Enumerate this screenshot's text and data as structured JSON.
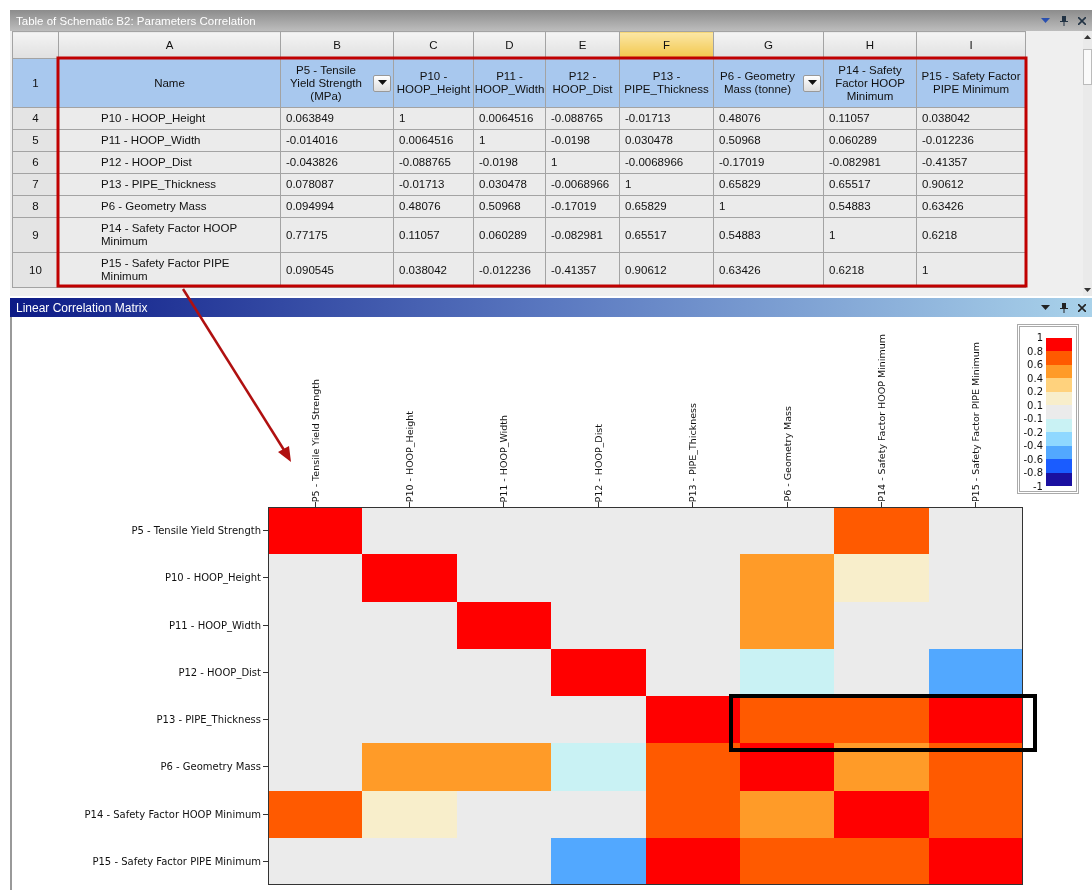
{
  "table_panel": {
    "title": "Table of Schematic B2: Parameters Correlation",
    "columns": [
      {
        "letter": "A",
        "selected": false
      },
      {
        "letter": "B",
        "selected": false
      },
      {
        "letter": "C",
        "selected": false
      },
      {
        "letter": "D",
        "selected": false
      },
      {
        "letter": "E",
        "selected": false
      },
      {
        "letter": "F",
        "selected": true
      },
      {
        "letter": "G",
        "selected": false
      },
      {
        "letter": "H",
        "selected": false
      },
      {
        "letter": "I",
        "selected": false
      }
    ],
    "header_row": {
      "number": "1",
      "cells": [
        {
          "text": "Name",
          "filter": false
        },
        {
          "text": "P5 - Tensile Yield Strength (MPa)",
          "filter": true
        },
        {
          "text": "P10 - HOOP_Height",
          "filter": false
        },
        {
          "text": "P11 - HOOP_Width",
          "filter": false
        },
        {
          "text": "P12 - HOOP_Dist",
          "filter": false
        },
        {
          "text": "P13 - PIPE_Thickness",
          "filter": false
        },
        {
          "text": "P6 - Geometry Mass (tonne)",
          "filter": true
        },
        {
          "text": "P14 - Safety Factor HOOP Minimum",
          "filter": false
        },
        {
          "text": "P15 - Safety Factor PIPE Minimum",
          "filter": false
        }
      ]
    },
    "rows": [
      {
        "number": "4",
        "cells": [
          "P10 - HOOP_Height",
          "0.063849",
          "1",
          "0.0064516",
          "-0.088765",
          "-0.01713",
          "0.48076",
          "0.11057",
          "0.038042"
        ]
      },
      {
        "number": "5",
        "cells": [
          "P11 - HOOP_Width",
          "-0.014016",
          "0.0064516",
          "1",
          "-0.0198",
          "0.030478",
          "0.50968",
          "0.060289",
          "-0.012236"
        ]
      },
      {
        "number": "6",
        "cells": [
          "P12 - HOOP_Dist",
          "-0.043826",
          "-0.088765",
          "-0.0198",
          "1",
          "-0.0068966",
          "-0.17019",
          "-0.082981",
          "-0.41357"
        ]
      },
      {
        "number": "7",
        "cells": [
          "P13 - PIPE_Thickness",
          "0.078087",
          "-0.01713",
          "0.030478",
          "-0.0068966",
          "1",
          "0.65829",
          "0.65517",
          "0.90612"
        ]
      },
      {
        "number": "8",
        "cells": [
          "P6 - Geometry Mass",
          "0.094994",
          "0.48076",
          "0.50968",
          "-0.17019",
          "0.65829",
          "1",
          "0.54883",
          "0.63426"
        ]
      },
      {
        "number": "9",
        "cells": [
          "P14 - Safety Factor HOOP Minimum",
          "0.77175",
          "0.11057",
          "0.060289",
          "-0.082981",
          "0.65517",
          "0.54883",
          "1",
          "0.6218"
        ]
      },
      {
        "number": "10",
        "cells": [
          "P15 - Safety Factor PIPE Minimum",
          "0.090545",
          "0.038042",
          "-0.012236",
          "-0.41357",
          "0.90612",
          "0.63426",
          "0.6218",
          "1"
        ]
      }
    ]
  },
  "matrix_panel": {
    "title": "Linear Correlation Matrix",
    "column_labels": [
      "P5 - Tensile Yield Strength",
      "P10 - HOOP_Height",
      "P11 - HOOP_Width",
      "P12 - HOOP_Dist",
      "P13 - PIPE_Thickness",
      "P6 - Geometry Mass",
      "P14 - Safety Factor HOOP Minimum",
      "P15 - Safety Factor PIPE Minimum"
    ],
    "rows": [
      {
        "label": "P5 - Tensile Yield Strength",
        "cells": [
          {
            "color": "#ff0000"
          },
          {
            "color": "#ebebeb"
          },
          {
            "color": "#ebebeb"
          },
          {
            "color": "#ebebeb"
          },
          {
            "color": "#ebebeb"
          },
          {
            "color": "#ebebeb"
          },
          {
            "color": "#ff5a00"
          },
          {
            "color": "#ebebeb"
          }
        ]
      },
      {
        "label": "P10 - HOOP_Height",
        "cells": [
          {
            "color": "#ebebeb"
          },
          {
            "color": "#ff0000"
          },
          {
            "color": "#ebebeb"
          },
          {
            "color": "#ebebeb"
          },
          {
            "color": "#ebebeb"
          },
          {
            "color": "#ff9b28"
          },
          {
            "color": "#f8eecb"
          },
          {
            "color": "#ebebeb"
          }
        ]
      },
      {
        "label": "P11 - HOOP_Width",
        "cells": [
          {
            "color": "#ebebeb"
          },
          {
            "color": "#ebebeb"
          },
          {
            "color": "#ff0000"
          },
          {
            "color": "#ebebeb"
          },
          {
            "color": "#ebebeb"
          },
          {
            "color": "#ff9b28"
          },
          {
            "color": "#ebebeb"
          },
          {
            "color": "#ebebeb"
          }
        ]
      },
      {
        "label": "P12 - HOOP_Dist",
        "cells": [
          {
            "color": "#ebebeb"
          },
          {
            "color": "#ebebeb"
          },
          {
            "color": "#ebebeb"
          },
          {
            "color": "#ff0000"
          },
          {
            "color": "#ebebeb"
          },
          {
            "color": "#c9f2f4"
          },
          {
            "color": "#ebebeb"
          },
          {
            "color": "#52a8ff"
          }
        ]
      },
      {
        "label": "P13 - PIPE_Thickness",
        "cells": [
          {
            "color": "#ebebeb"
          },
          {
            "color": "#ebebeb"
          },
          {
            "color": "#ebebeb"
          },
          {
            "color": "#ebebeb"
          },
          {
            "color": "#ff0000"
          },
          {
            "color": "#ff5a00"
          },
          {
            "color": "#ff5a00"
          },
          {
            "color": "#ff0000"
          }
        ]
      },
      {
        "label": "P6 - Geometry Mass",
        "cells": [
          {
            "color": "#ebebeb"
          },
          {
            "color": "#ff9b28"
          },
          {
            "color": "#ff9b28"
          },
          {
            "color": "#c9f2f4"
          },
          {
            "color": "#ff5a00"
          },
          {
            "color": "#ff0000"
          },
          {
            "color": "#ff9b28"
          },
          {
            "color": "#ff5a00"
          }
        ]
      },
      {
        "label": "P14 - Safety Factor HOOP Minimum",
        "cells": [
          {
            "color": "#ff5a00"
          },
          {
            "color": "#f8eecb"
          },
          {
            "color": "#ebebeb"
          },
          {
            "color": "#ebebeb"
          },
          {
            "color": "#ff5a00"
          },
          {
            "color": "#ff9b28"
          },
          {
            "color": "#ff0000"
          },
          {
            "color": "#ff5a00"
          }
        ]
      },
      {
        "label": "P15 - Safety Factor PIPE Minimum",
        "cells": [
          {
            "color": "#ebebeb"
          },
          {
            "color": "#ebebeb"
          },
          {
            "color": "#ebebeb"
          },
          {
            "color": "#52a8ff"
          },
          {
            "color": "#ff0000"
          },
          {
            "color": "#ff5a00"
          },
          {
            "color": "#ff5a00"
          },
          {
            "color": "#ff0000"
          }
        ]
      }
    ],
    "legend_labels": [
      "1",
      "0.8",
      "0.6",
      "0.4",
      "0.2",
      "0.1",
      "-0.1",
      "-0.2",
      "-0.4",
      "-0.6",
      "-0.8",
      "-1"
    ],
    "legend_swatches": [
      {
        "color": "#ff0000"
      },
      {
        "color": "#ff5a00"
      },
      {
        "color": "#ff9b28"
      },
      {
        "color": "#ffd27d"
      },
      {
        "color": "#f8eecb"
      },
      {
        "color": "#ebebeb"
      },
      {
        "color": "#c9f2f4"
      },
      {
        "color": "#8fd8ff"
      },
      {
        "color": "#52a8ff"
      },
      {
        "color": "#1a5cff"
      },
      {
        "color": "#1a10a0"
      }
    ]
  },
  "annotations": [
    {
      "kind": "red_frame"
    },
    {
      "kind": "red_arrow"
    },
    {
      "kind": "black_frame"
    }
  ]
}
